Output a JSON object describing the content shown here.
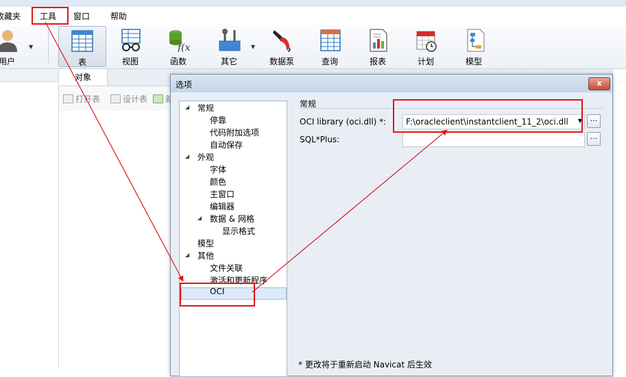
{
  "menu": {
    "items": [
      {
        "label": "收藏夹"
      },
      {
        "label": "工具"
      },
      {
        "label": "窗口"
      },
      {
        "label": "帮助"
      }
    ]
  },
  "toolbar": {
    "user_label": "用户",
    "table_label": "表",
    "view_label": "视图",
    "function_label": "函数",
    "other_label": "其它",
    "datapump_label": "数据泵",
    "query_label": "查询",
    "report_label": "报表",
    "schedule_label": "计划",
    "model_label": "模型"
  },
  "objects": {
    "tab_label": "对象",
    "open_table": "打开表",
    "design_table": "设计表",
    "new_partial": "新"
  },
  "dialog": {
    "title": "选项",
    "close_label": "x",
    "tree": [
      {
        "label": "常规",
        "level": 0,
        "expanded": true
      },
      {
        "label": "停靠",
        "level": 1
      },
      {
        "label": "代码附加选项",
        "level": 1
      },
      {
        "label": "自动保存",
        "level": 1
      },
      {
        "label": "外观",
        "level": 0,
        "expanded": true
      },
      {
        "label": "字体",
        "level": 1
      },
      {
        "label": "颜色",
        "level": 1
      },
      {
        "label": "主窗口",
        "level": 1
      },
      {
        "label": "编辑器",
        "level": 1
      },
      {
        "label": "数据 & 网格",
        "level": 1,
        "expanded": true
      },
      {
        "label": "显示格式",
        "level": 2
      },
      {
        "label": "模型",
        "level": 0
      },
      {
        "label": "其他",
        "level": 0,
        "expanded": true
      },
      {
        "label": "文件关联",
        "level": 1
      },
      {
        "label": "激活和更新程序",
        "level": 1
      },
      {
        "label": "OCI",
        "level": 1,
        "selected": true
      }
    ],
    "section_title": "常规",
    "oci_label": "OCI library (oci.dll) *:",
    "oci_value": "F:\\oracleclient\\instantclient_11_2\\oci.dll",
    "sqlplus_label": "SQL*Plus:",
    "sqlplus_value": "",
    "browse_label": "...",
    "note": "* 更改将于重新启动 Navicat 后生效"
  },
  "colors": {
    "annotation_red": "#e0141a",
    "selection": "#dce9f8"
  }
}
